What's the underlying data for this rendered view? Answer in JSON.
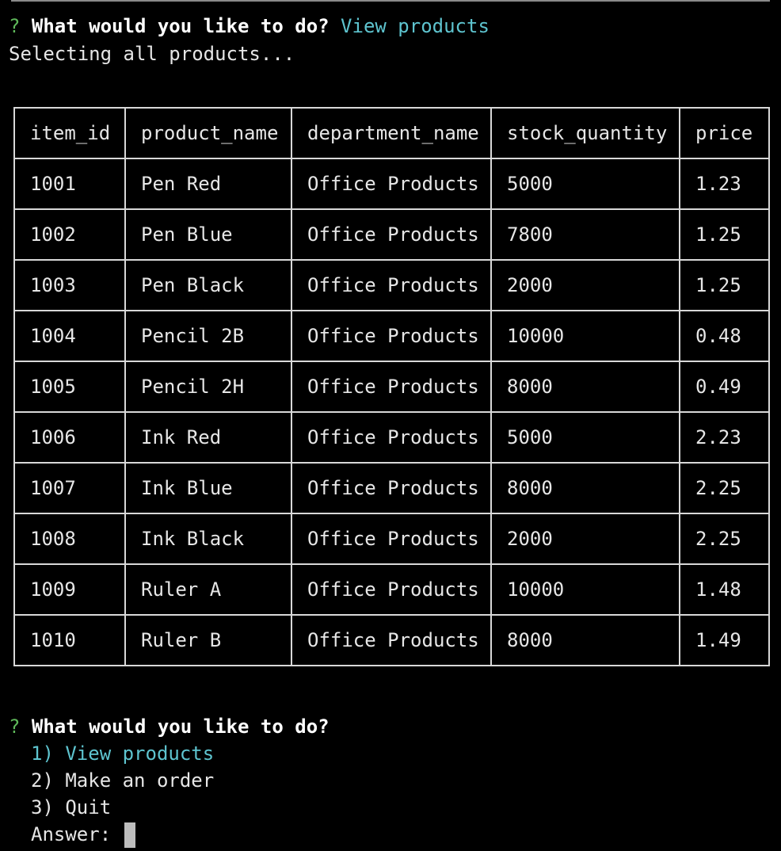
{
  "prompt1": {
    "marker": "?",
    "question": "What would you like to do?",
    "answer": "View products"
  },
  "status_text": "Selecting all products...",
  "table": {
    "headers": [
      "item_id",
      "product_name",
      "department_name",
      "stock_quantity",
      "price"
    ],
    "rows": [
      [
        "1001",
        "Pen Red",
        "Office Products",
        "5000",
        "1.23"
      ],
      [
        "1002",
        "Pen Blue",
        "Office Products",
        "7800",
        "1.25"
      ],
      [
        "1003",
        "Pen Black",
        "Office Products",
        "2000",
        "1.25"
      ],
      [
        "1004",
        "Pencil 2B",
        "Office Products",
        "10000",
        "0.48"
      ],
      [
        "1005",
        "Pencil 2H",
        "Office Products",
        "8000",
        "0.49"
      ],
      [
        "1006",
        "Ink Red",
        "Office Products",
        "5000",
        "2.23"
      ],
      [
        "1007",
        "Ink Blue",
        "Office Products",
        "8000",
        "2.25"
      ],
      [
        "1008",
        "Ink Black",
        "Office Products",
        "2000",
        "2.25"
      ],
      [
        "1009",
        "Ruler A",
        "Office Products",
        "10000",
        "1.48"
      ],
      [
        "1010",
        "Ruler B",
        "Office Products",
        "8000",
        "1.49"
      ]
    ]
  },
  "prompt2": {
    "marker": "?",
    "question": "What would you like to do?",
    "options": [
      "1) View products",
      "2) Make an order",
      "3) Quit"
    ],
    "answer_label": "Answer:"
  },
  "colors": {
    "background": "#000000",
    "marker": "#5fb85a",
    "selected_answer": "#5ec4cf",
    "text": "#e6e6e6",
    "border": "#d8d8d8"
  }
}
